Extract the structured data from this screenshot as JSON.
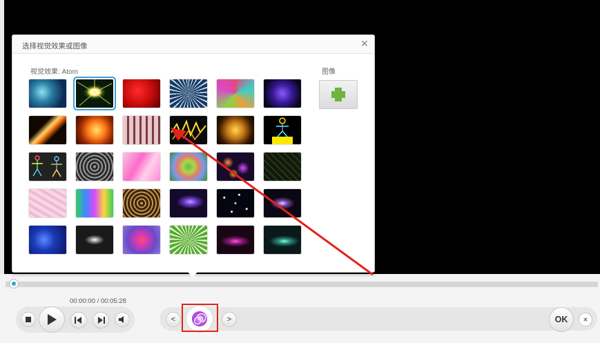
{
  "dialog": {
    "title": "选择视觉效果或图像",
    "close_icon": "close-icon",
    "effects_label": "视觉效果: Atom",
    "images_label": "图像",
    "add_image_icon": "plus-icon",
    "add_image_color": "#6fb43f",
    "selected_color": "#3ba1dd"
  },
  "effects": {
    "rows": [
      [
        "effect-teal-nebula",
        "effect-atom",
        "effect-red",
        "effect-blue-rays",
        "effect-kaleido",
        "effect-purple-lines"
      ],
      [
        "effect-fire-streak",
        "effect-fire-burst",
        "effect-pink-room",
        "effect-yellow-lightning",
        "effect-golden-kaleido",
        "effect-stick-figure"
      ],
      [
        "effect-stick-figures",
        "effect-grey-swirl",
        "effect-pink-flow",
        "effect-rainbow-ring",
        "effect-dark-dots",
        "effect-green-grid"
      ],
      [
        "effect-pink-pattern",
        "effect-rainbow-paint",
        "effect-gold-swirl",
        "effect-purple-galaxy",
        "effect-starfield",
        "effect-purple-space"
      ],
      [
        "effect-blue-particles",
        "effect-eye-particles",
        "effect-magenta-swirl",
        "effect-green-starburst",
        "effect-magenta-wave",
        "effect-teal-particles"
      ]
    ],
    "selected": "effect-atom"
  },
  "player": {
    "time": "00:00:00 / 00:05:28",
    "progress": 0,
    "stop_icon": "stop-icon",
    "play_icon": "play-icon",
    "prev_icon": "previous-icon",
    "next_icon": "next-icon",
    "volume_icon": "volume-icon"
  },
  "effect_bar": {
    "prev_label": "<",
    "next_label": ">",
    "current_icon": "spiral-icon",
    "ok_label": "OK",
    "close_label": "×"
  },
  "colors": {
    "annotation": "#e2231a",
    "accent": "#3ba1dd"
  }
}
